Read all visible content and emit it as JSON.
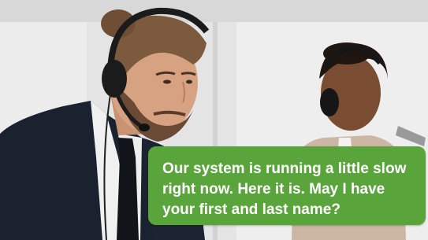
{
  "caption": {
    "lines": [
      "Our system is running a little slow",
      "right now. Here it is. May I have",
      "your first and last name?"
    ],
    "background_color": "#5aa53b",
    "text_color": "#ffffff"
  },
  "colors": {
    "wall": "#e6e6e6",
    "suit": "#1a2230",
    "shirt": "#f2f2f2",
    "beige_jacket": "#cdb9a6",
    "headset": "#1b1b1b"
  }
}
